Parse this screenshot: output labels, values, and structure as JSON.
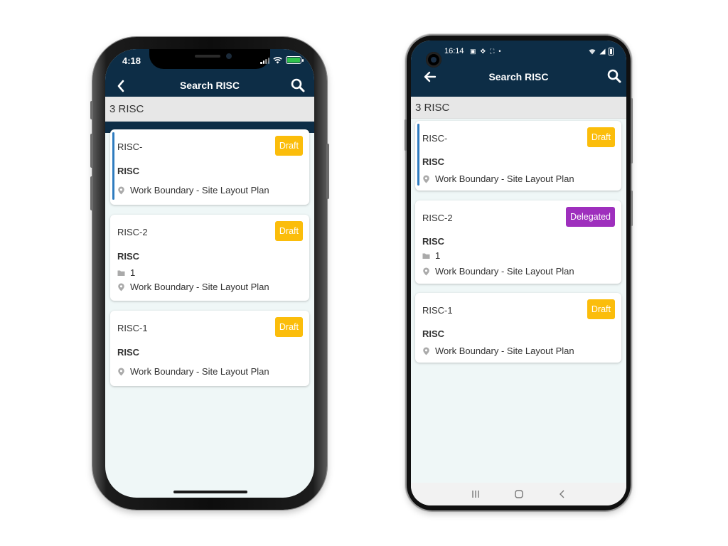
{
  "iphone": {
    "status_time": "4:18",
    "nav_title": "Search RISC",
    "count_label": "3 RISC",
    "cards": [
      {
        "ref": "RISC-",
        "type": "RISC",
        "status": "Draft",
        "location": "Work Boundary - Site Layout Plan",
        "selected": true
      },
      {
        "ref": "RISC-2",
        "type": "RISC",
        "status": "Draft",
        "folder_count": "1",
        "location": "Work Boundary - Site Layout Plan"
      },
      {
        "ref": "RISC-1",
        "type": "RISC",
        "status": "Draft",
        "location": "Work Boundary - Site Layout Plan"
      }
    ]
  },
  "android": {
    "status_time": "16:14",
    "nav_title": "Search RISC",
    "count_label": "3 RISC",
    "cards": [
      {
        "ref": "RISC-",
        "type": "RISC",
        "status": "Draft",
        "location": "Work Boundary - Site Layout Plan",
        "selected": true
      },
      {
        "ref": "RISC-2",
        "type": "RISC",
        "status": "Delegated",
        "folder_count": "1",
        "location": "Work Boundary - Site Layout Plan"
      },
      {
        "ref": "RISC-1",
        "type": "RISC",
        "status": "Draft",
        "location": "Work Boundary - Site Layout Plan"
      }
    ]
  },
  "colors": {
    "header_bg": "#0d2d46",
    "draft_badge": "#fbbd0b",
    "delegated_badge": "#9e2fbd",
    "selected_accent": "#2f7cbf",
    "screen_bg": "#eff7f7",
    "count_bar_bg": "#e7e7e7"
  },
  "icons": {
    "back": "arrow-left-icon",
    "search": "search-icon",
    "location": "map-pin-icon",
    "folder": "folder-icon"
  }
}
